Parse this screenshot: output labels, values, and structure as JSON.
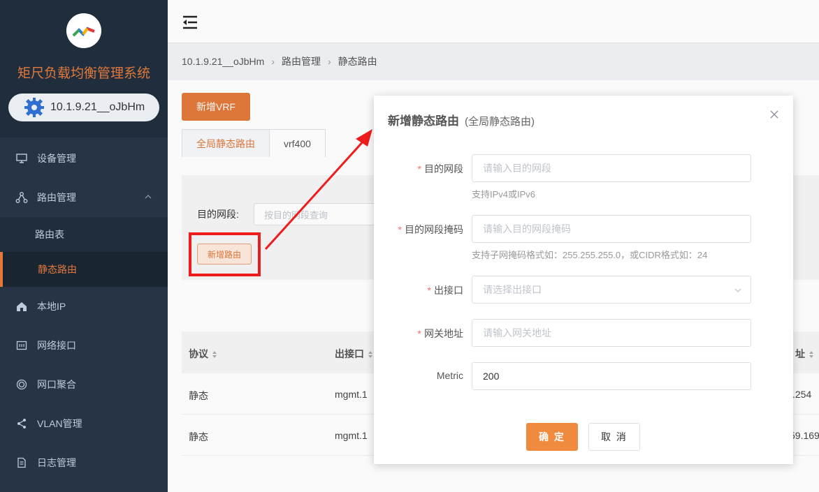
{
  "app": {
    "title": "矩尺负载均衡管理系统",
    "device": "10.1.9.21__oJbHm"
  },
  "colors": {
    "accent": "#e2793b",
    "sidebar_bg": "#263445",
    "annotation_red": "#ee1c1c"
  },
  "sidebar": {
    "items": [
      {
        "label": "设备管理",
        "icon": "monitor-icon"
      },
      {
        "label": "路由管理",
        "icon": "share-nodes-icon"
      },
      {
        "label": "路由表",
        "icon": ""
      },
      {
        "label": "静态路由",
        "icon": ""
      },
      {
        "label": "本地IP",
        "icon": "home-icon"
      },
      {
        "label": "网络接口",
        "icon": "ethernet-port-icon"
      },
      {
        "label": "网口聚合",
        "icon": "aggregate-icon"
      },
      {
        "label": "VLAN管理",
        "icon": "share-icon"
      },
      {
        "label": "日志管理",
        "icon": "document-icon"
      }
    ]
  },
  "breadcrumb": [
    "10.1.9.21__oJbHm",
    "路由管理",
    "静态路由"
  ],
  "page": {
    "new_vrf": "新增VRF",
    "tabs": [
      "全局静态路由",
      "vrf400"
    ],
    "filter_label": "目的网段:",
    "filter_placeholder": "按目的网段查询",
    "add_route": "新增路由"
  },
  "table": {
    "columns": [
      "协议",
      "出接口",
      "址"
    ],
    "rows": [
      [
        "静态",
        "mgmt.1",
        ".254"
      ],
      [
        "静态",
        "mgmt.1",
        "59.169"
      ]
    ]
  },
  "dialog": {
    "title": "新增静态路由",
    "subtitle": "(全局静态路由)",
    "fields": [
      {
        "label": "目的网段",
        "required": true,
        "placeholder": "请输入目的网段",
        "value": "",
        "hint": "支持IPv4或IPv6"
      },
      {
        "label": "目的网段掩码",
        "required": true,
        "placeholder": "请输入目的网段掩码",
        "value": "",
        "hint": "支持子网掩码格式如：255.255.255.0，或CIDR格式如：24"
      },
      {
        "label": "出接口",
        "required": true,
        "placeholder": "请选择出接口",
        "value": "",
        "hint": ""
      },
      {
        "label": "网关地址",
        "required": true,
        "placeholder": "请输入网关地址",
        "value": "",
        "hint": ""
      },
      {
        "label": "Metric",
        "required": false,
        "placeholder": "",
        "value": "200",
        "hint": ""
      }
    ],
    "confirm": "确 定",
    "cancel": "取 消"
  }
}
